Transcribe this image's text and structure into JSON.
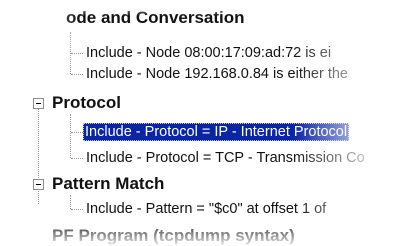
{
  "tree": {
    "groups": [
      {
        "title": "ode and Conversation",
        "items": [
          {
            "label": "Include - Node 08:00:17:09:ad:72 is ei"
          },
          {
            "label": "Include - Node 192.168.0.84 is either the"
          }
        ]
      },
      {
        "title": "Protocol",
        "expander": "minus-icon",
        "items": [
          {
            "label": "Include - Protocol = IP - Internet Protocol",
            "selected": true
          },
          {
            "label": "Include - Protocol = TCP - Transmission Co"
          }
        ]
      },
      {
        "title": "Pattern Match",
        "expander": "minus-icon",
        "items": [
          {
            "label": "Include - Pattern = \"$c0\" at offset 1 of"
          }
        ]
      },
      {
        "title": "PF Program (tcpdump syntax)"
      }
    ]
  },
  "colors": {
    "selection_background": "#0a24a6",
    "selection_text": "#ffffff",
    "tree_line": "#9a9a9a"
  }
}
